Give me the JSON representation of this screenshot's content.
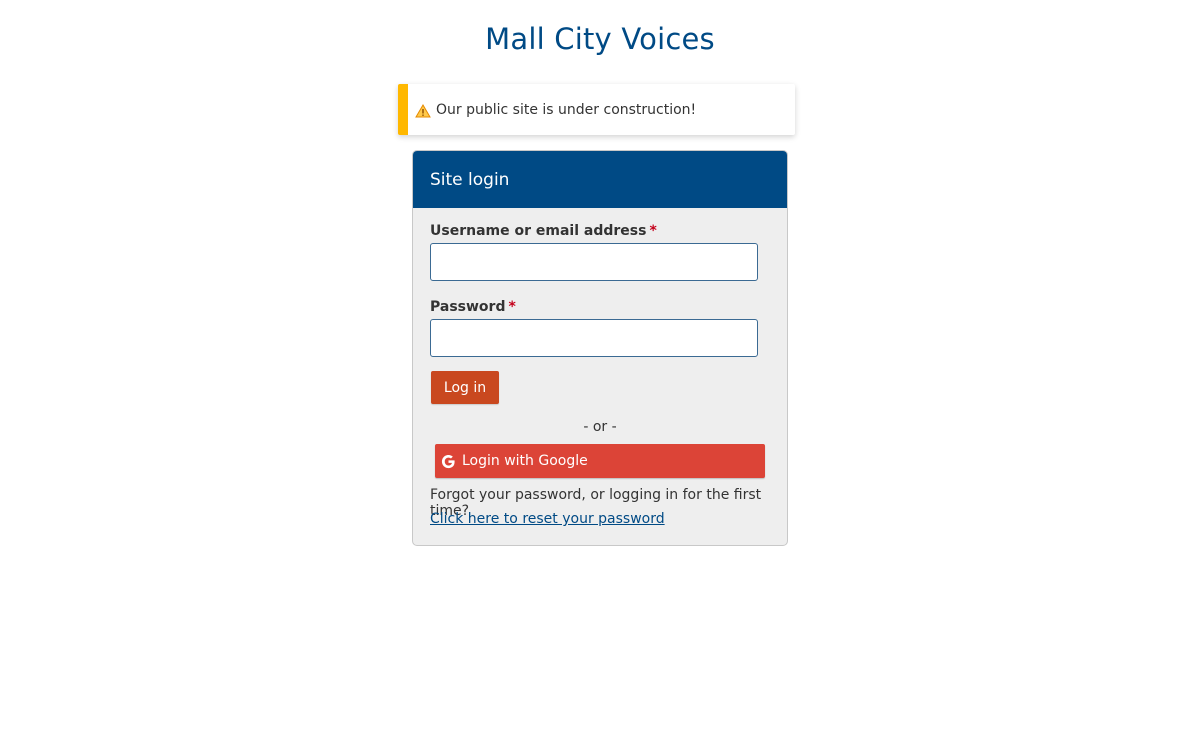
{
  "site": {
    "title": "Mall City Voices"
  },
  "notice": {
    "icon": "warning-icon",
    "text": "Our public site is under construction!",
    "accent_color": "#ffb800"
  },
  "login": {
    "header": "Site login",
    "header_color": "#004a85",
    "username_label": "Username or email address",
    "username_value": "",
    "password_label": "Password",
    "password_value": "",
    "required_marker": "*",
    "submit_label": "Log in",
    "submit_color": "#c9481f",
    "or_text": "- or -",
    "google_label": "Login with Google",
    "google_icon": "google-g-icon",
    "google_color": "#dc4437",
    "forgot_text": "Forgot your password, or logging in for the first time?",
    "reset_link": "Click here to reset your password"
  }
}
